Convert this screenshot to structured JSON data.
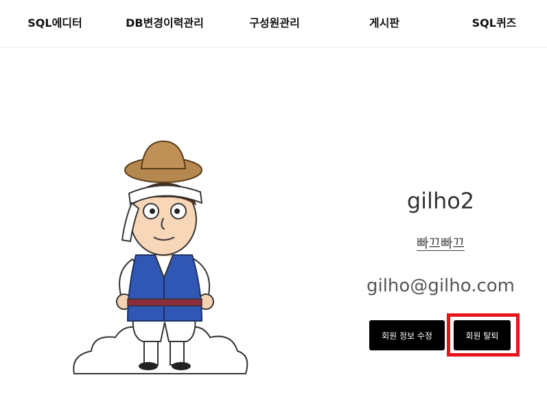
{
  "nav": {
    "items": [
      {
        "label": "SQL에디터"
      },
      {
        "label": "DB변경이력관리"
      },
      {
        "label": "구성원관리"
      },
      {
        "label": "게시판"
      },
      {
        "label": "SQL퀴즈"
      }
    ]
  },
  "profile": {
    "username": "gilho2",
    "nickname": "빠끄빠끄",
    "email": "gilho@gilho.com",
    "edit_label": "회원 정보 수정",
    "delete_label": "회원 탈퇴"
  },
  "colors": {
    "button_bg": "#000000",
    "highlight": "#e8141b"
  }
}
